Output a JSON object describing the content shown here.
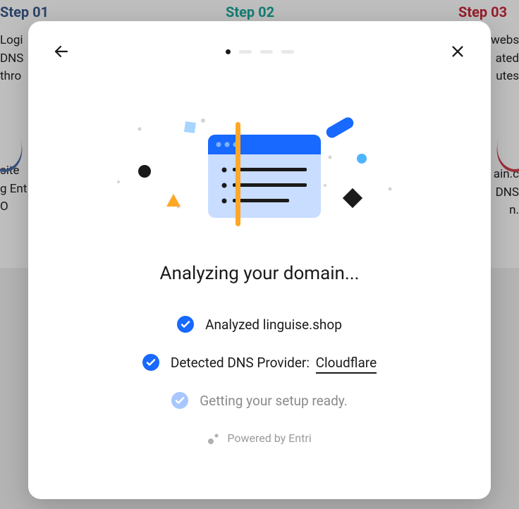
{
  "background": {
    "steps": {
      "step01": "Step 01",
      "step02": "Step 02",
      "step03": "Step 03"
    },
    "fragments": {
      "topLeft": "Logi\nDNS\nthro",
      "topRight": "websi\nated\nutes",
      "bottomLeft": "site\ng Ent\nO",
      "bottomRight": "ain.c\nDNS\nn."
    }
  },
  "modal": {
    "progress": {
      "current": 1,
      "total": 4
    },
    "heading": "Analyzing your domain...",
    "status": [
      {
        "state": "done",
        "text": "Analyzed linguise.shop"
      },
      {
        "state": "done",
        "textPrefix": "Detected DNS Provider: ",
        "provider": "Cloudflare"
      },
      {
        "state": "pending",
        "text": "Getting your setup ready."
      }
    ],
    "poweredBy": "Powered by Entri"
  },
  "icons": {
    "back": "back-arrow",
    "close": "close-x"
  },
  "colors": {
    "primary": "#1769ff",
    "pending": "#a8c7ff"
  }
}
